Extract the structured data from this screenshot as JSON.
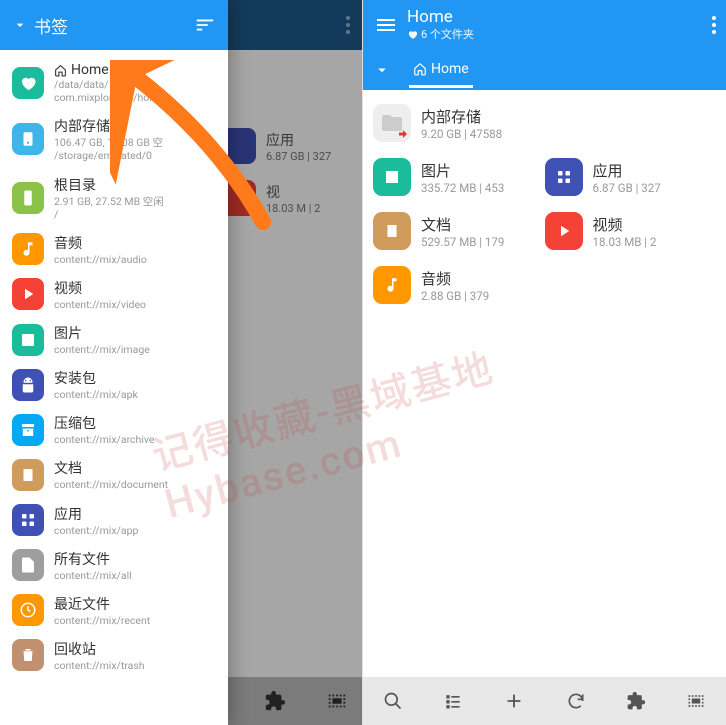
{
  "left": {
    "drawer": {
      "title": "书签",
      "items": [
        {
          "name": "Home",
          "sub": "/data/data/\ncom.mixplorer   er/home",
          "color": "#1abc9c",
          "home": true
        },
        {
          "name": "内部存储",
          "sub": "106.47 GB, 12.08 GB 空\n/storage/emulated/0",
          "color": "#3fb6e8"
        },
        {
          "name": "根目录",
          "sub": "2.91 GB, 27.52 MB 空闲\n/",
          "color": "#8bc34a"
        },
        {
          "name": "音频",
          "sub": "content://mix/audio",
          "color": "#ff9800"
        },
        {
          "name": "视频",
          "sub": "content://mix/video",
          "color": "#f44336"
        },
        {
          "name": "图片",
          "sub": "content://mix/image",
          "color": "#1abc9c"
        },
        {
          "name": "安装包",
          "sub": "content://mix/apk",
          "color": "#3f51b5"
        },
        {
          "name": "压缩包",
          "sub": "content://mix/archive",
          "color": "#03a9f4"
        },
        {
          "name": "文档",
          "sub": "content://mix/document",
          "color": "#d09c5e"
        },
        {
          "name": "应用",
          "sub": "content://mix/app",
          "color": "#3f51b5"
        },
        {
          "name": "所有文件",
          "sub": "content://mix/all",
          "color": "#9e9e9e"
        },
        {
          "name": "最近文件",
          "sub": "content://mix/recent",
          "color": "#ff9800"
        },
        {
          "name": "回收站",
          "sub": "content://mix/trash",
          "color": "#c09070"
        }
      ]
    },
    "behind": [
      {
        "name": "应用",
        "sub": "6.87 GB | 327",
        "color": "#3f51b5"
      },
      {
        "name": "视",
        "sub": "18.03 M  | 2",
        "color": "#f44336"
      }
    ]
  },
  "right": {
    "header": {
      "title": "Home",
      "sub": "6 个文件夹"
    },
    "tab": "Home",
    "storage": {
      "name": "内部存储",
      "sub": "9.20 GB | 47588"
    },
    "grid": [
      {
        "name": "图片",
        "sub": "335.72 MB | 453",
        "color": "#1abc9c",
        "icon": "image"
      },
      {
        "name": "应用",
        "sub": "6.87 GB | 327",
        "color": "#3f51b5",
        "icon": "apps"
      },
      {
        "name": "文档",
        "sub": "529.57 MB | 179",
        "color": "#d09c5e",
        "icon": "doc"
      },
      {
        "name": "视频",
        "sub": "18.03 MB | 2",
        "color": "#f44336",
        "icon": "video"
      },
      {
        "name": "音频",
        "sub": "2.88 GB | 379",
        "color": "#ff9800",
        "icon": "audio"
      }
    ]
  },
  "watermark": "记得收藏-黑域基地  Hybase.com"
}
